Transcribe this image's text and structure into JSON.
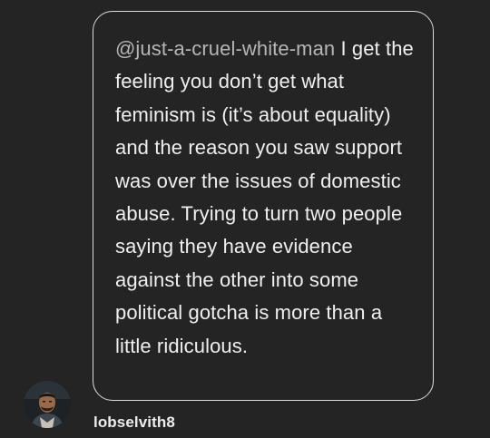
{
  "post": {
    "mention": "@just-a-cruel-white-man",
    "text": " I get the feeling you don’t get what feminism is (it’s about equality) and the reason you saw support was over the issues of domestic abuse. Trying to turn two people saying they have evidence against the other into some political gotcha is more than a little ridiculous."
  },
  "author": {
    "username": "lobselvith8",
    "avatar_icon": "person-avatar"
  },
  "colors": {
    "background": "#242424",
    "bubble_border": "#dcdcdc",
    "text": "#efefef",
    "mention": "#b6b6b6"
  }
}
